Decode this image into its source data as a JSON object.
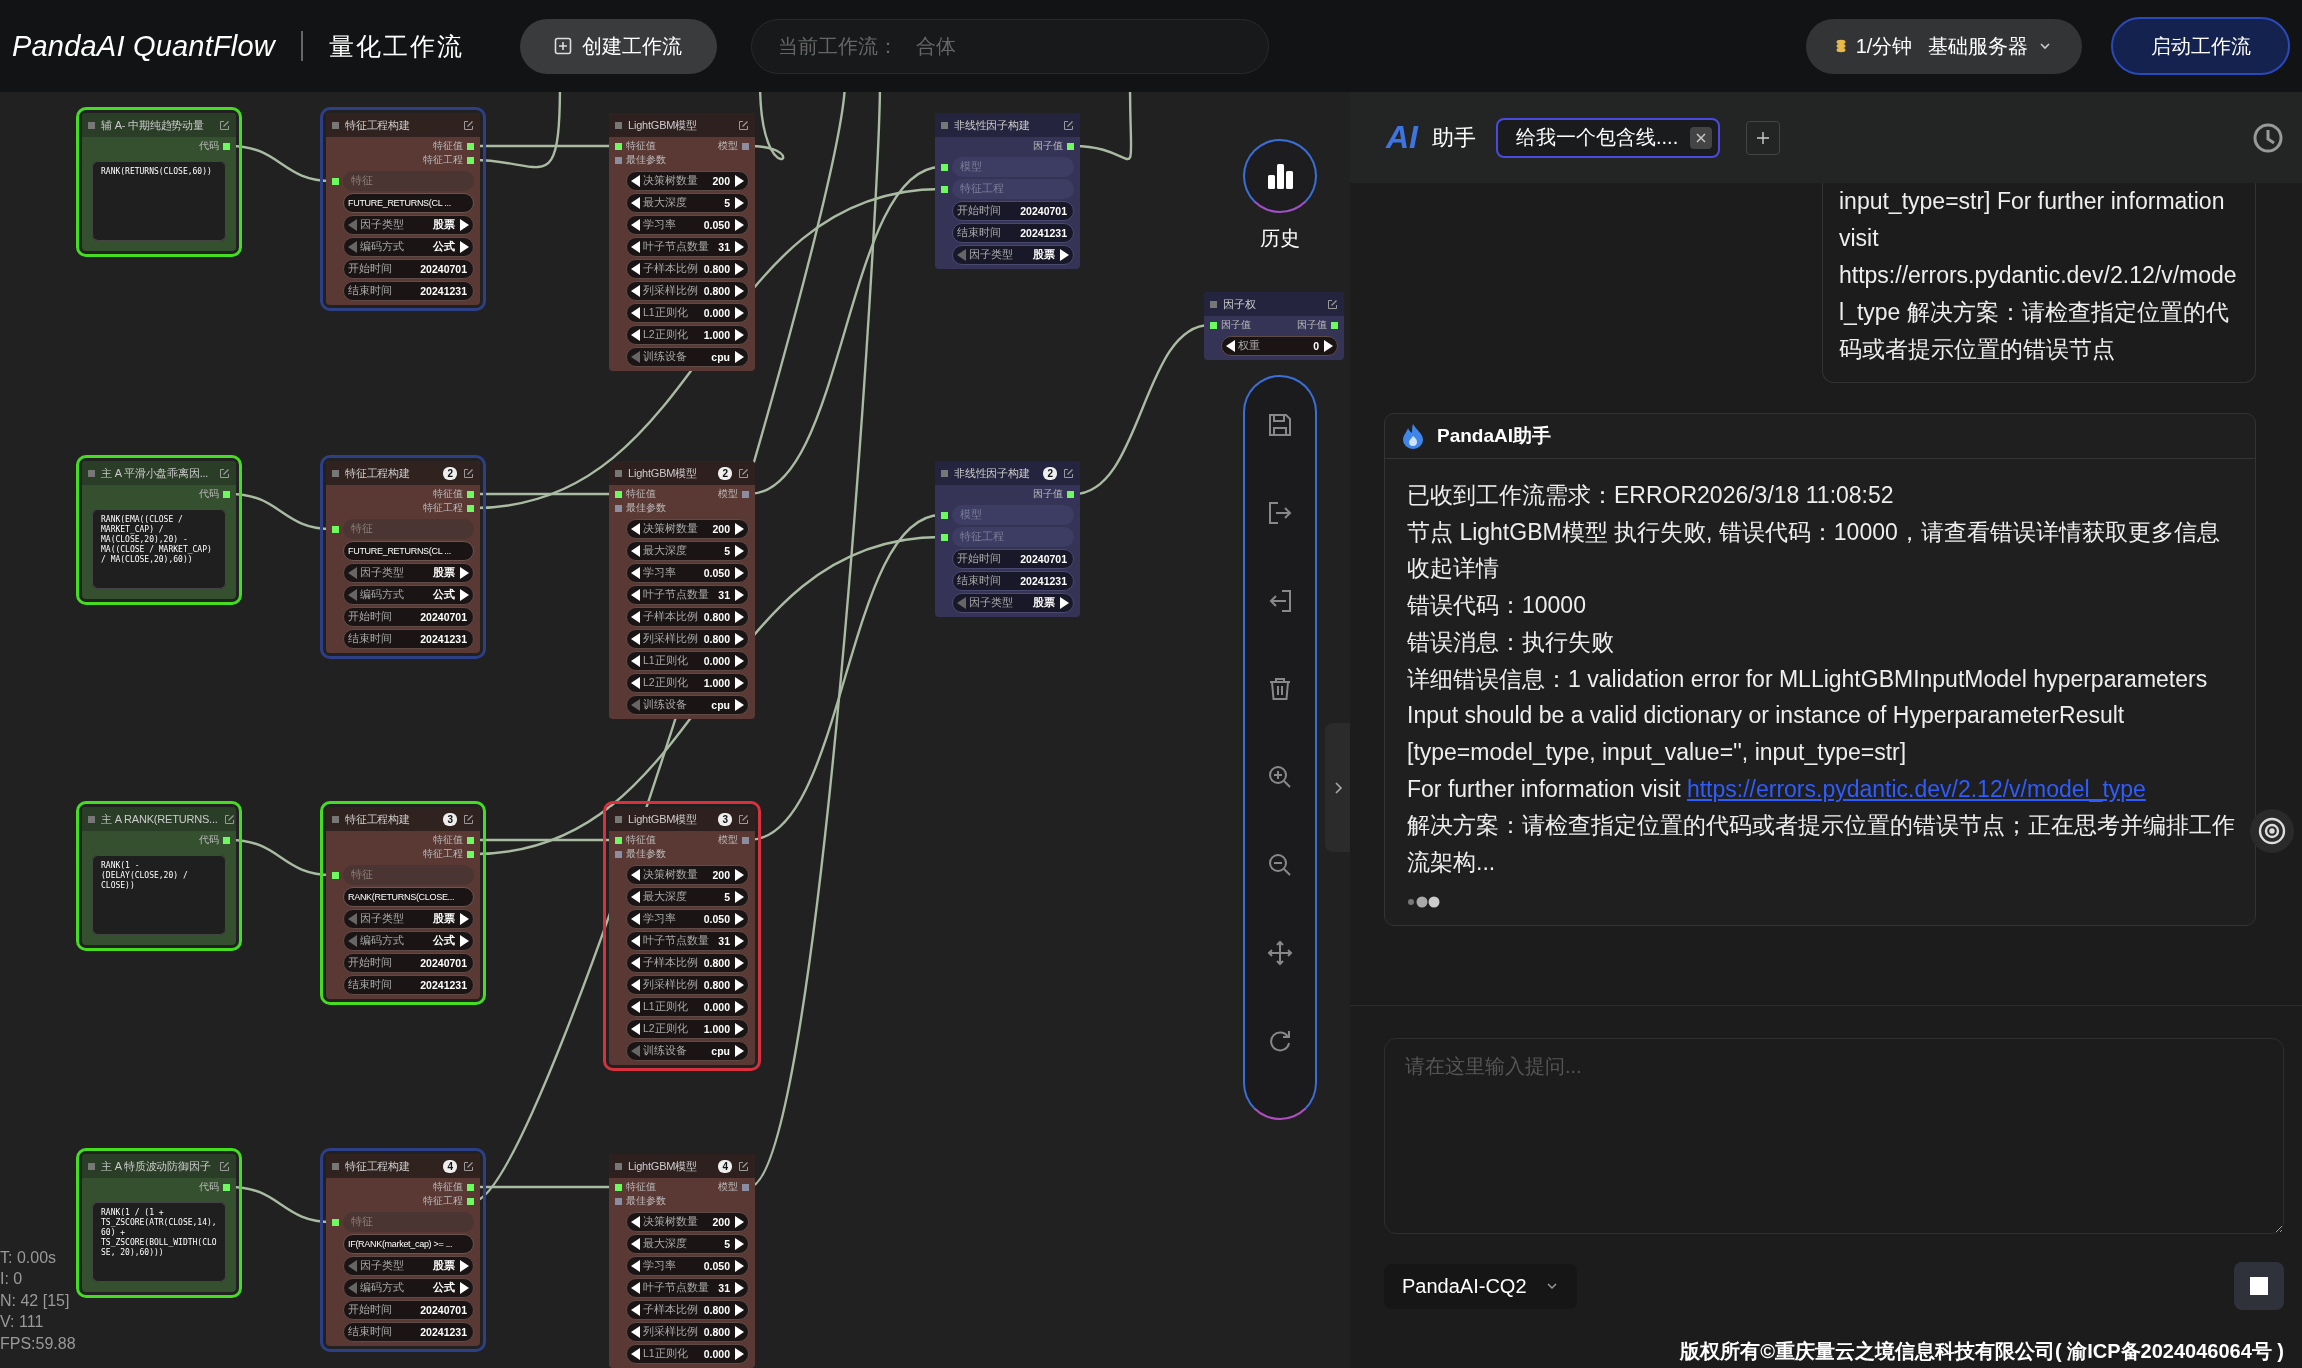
{
  "app": {
    "logo": "PandaAI QuantFlow",
    "subtitle": "量化工作流"
  },
  "toolbar": {
    "create_button": "创建工作流",
    "current_workflow": {
      "label": "当前工作流：",
      "value": "合体"
    },
    "server": {
      "rate": "1/分钟",
      "name": "基础服务器"
    },
    "start_button": "启动工作流"
  },
  "canvas": {
    "nodes": [
      {
        "kind": "code",
        "title": "辅 A- 中期纯趋势动量",
        "color": "#44dd22",
        "port_rows": [
          {
            "output": {
              "label": "代码",
              "connected": true
            }
          }
        ],
        "widgets": [
          {
            "kind": "code",
            "value": "RANK(RETURNS(CLOSE,60))"
          }
        ]
      },
      {
        "kind": "feature",
        "title": "特征工程构建",
        "color": "#2d3f86",
        "port_rows": [
          {
            "output": {
              "label": "特征值",
              "connected": true
            }
          },
          {
            "output": {
              "label": "特征工程",
              "connected": true
            }
          }
        ],
        "widgets": [
          {
            "kind": "input",
            "label": "特征",
            "connected": true
          },
          {
            "kind": "text",
            "value": "FUTURE_RETURNS(CL  ..."
          },
          {
            "kind": "combo",
            "label": "因子类型",
            "value": "股票"
          },
          {
            "kind": "combo",
            "label": "编码方式",
            "value": "公式"
          },
          {
            "kind": "field",
            "label": "开始时间",
            "value": "20240701"
          },
          {
            "kind": "field",
            "label": "结束时间",
            "value": "20241231"
          }
        ]
      },
      {
        "kind": "model",
        "title": "LightGBM模型",
        "port_rows": [
          {
            "input": {
              "label": "特征值",
              "connected": true
            },
            "output": {
              "label": "模型",
              "connected": false
            }
          },
          {
            "input": {
              "label": "最佳参数",
              "connected": false
            }
          }
        ],
        "widgets": [
          {
            "kind": "number",
            "label": "决策树数量",
            "value": "200"
          },
          {
            "kind": "number",
            "label": "最大深度",
            "value": "5"
          },
          {
            "kind": "number",
            "label": "学习率",
            "value": "0.050"
          },
          {
            "kind": "number",
            "label": "叶子节点数量",
            "value": "31"
          },
          {
            "kind": "number",
            "label": "子样本比例",
            "value": "0.800"
          },
          {
            "kind": "number",
            "label": "列采样比例",
            "value": "0.800"
          },
          {
            "kind": "number",
            "label": "L1正则化",
            "value": "0.000"
          },
          {
            "kind": "number",
            "label": "L2正则化",
            "value": "1.000"
          },
          {
            "kind": "combo",
            "label": "训练设备",
            "value": "cpu"
          }
        ]
      },
      {
        "kind": "nonlinear",
        "title": "非线性因子构建",
        "port_rows": [
          {
            "output": {
              "label": "因子值",
              "connected": true
            }
          }
        ],
        "widgets": [
          {
            "kind": "input",
            "label": "模型",
            "connected": true
          },
          {
            "kind": "input",
            "label": "特征工程",
            "connected": true
          },
          {
            "kind": "field",
            "label": "开始时间",
            "value": "20240701"
          },
          {
            "kind": "field",
            "label": "结束时间",
            "value": "20241231"
          },
          {
            "kind": "combo",
            "label": "因子类型",
            "value": "股票"
          }
        ]
      },
      {
        "kind": "weight",
        "title": "因子权",
        "port_rows": [
          {
            "input": {
              "label": "因子值",
              "connected": true
            },
            "output": {
              "label": "因子值",
              "connected": true
            }
          }
        ],
        "widgets": [
          {
            "kind": "number",
            "label": "权重",
            "value": "0"
          }
        ]
      },
      {
        "kind": "code",
        "title": "主 A 平滑小盘乖离因...",
        "color": "#44dd22",
        "port_rows": [
          {
            "output": {
              "label": "代码",
              "connected": true
            }
          }
        ],
        "widgets": [
          {
            "kind": "code",
            "value": "RANK(EMA((CLOSE / MARKET_CAP) / MA(CLOSE,20),20) - MA((CLOSE / MARKET_CAP) / MA(CLOSE,20),60))"
          }
        ]
      },
      {
        "kind": "feature",
        "title": "特征工程构建",
        "badge": "2",
        "color": "#2d3f86",
        "port_rows": [
          {
            "output": {
              "label": "特征值",
              "connected": true
            }
          },
          {
            "output": {
              "label": "特征工程",
              "connected": true
            }
          }
        ],
        "widgets": [
          {
            "kind": "input",
            "label": "特征",
            "connected": true
          },
          {
            "kind": "text",
            "value": "FUTURE_RETURNS(CL  ..."
          },
          {
            "kind": "combo",
            "label": "因子类型",
            "value": "股票"
          },
          {
            "kind": "combo",
            "label": "编码方式",
            "value": "公式"
          },
          {
            "kind": "field",
            "label": "开始时间",
            "value": "20240701"
          },
          {
            "kind": "field",
            "label": "结束时间",
            "value": "20241231"
          }
        ]
      },
      {
        "kind": "model",
        "title": "LightGBM模型",
        "badge": "2",
        "port_rows": [
          {
            "input": {
              "label": "特征值",
              "connected": true
            },
            "output": {
              "label": "模型",
              "connected": false
            }
          },
          {
            "input": {
              "label": "最佳参数",
              "connected": false
            }
          }
        ],
        "widgets": [
          {
            "kind": "number",
            "label": "决策树数量",
            "value": "200"
          },
          {
            "kind": "number",
            "label": "最大深度",
            "value": "5"
          },
          {
            "kind": "number",
            "label": "学习率",
            "value": "0.050"
          },
          {
            "kind": "number",
            "label": "叶子节点数量",
            "value": "31"
          },
          {
            "kind": "number",
            "label": "子样本比例",
            "value": "0.800"
          },
          {
            "kind": "number",
            "label": "列采样比例",
            "value": "0.800"
          },
          {
            "kind": "number",
            "label": "L1正则化",
            "value": "0.000"
          },
          {
            "kind": "number",
            "label": "L2正则化",
            "value": "1.000"
          },
          {
            "kind": "combo",
            "label": "训练设备",
            "value": "cpu"
          }
        ]
      },
      {
        "kind": "nonlinear",
        "title": "非线性因子构建",
        "badge": "2",
        "port_rows": [
          {
            "output": {
              "label": "因子值",
              "connected": true
            }
          }
        ],
        "widgets": [
          {
            "kind": "input",
            "label": "模型",
            "connected": true
          },
          {
            "kind": "input",
            "label": "特征工程",
            "connected": true
          },
          {
            "kind": "field",
            "label": "开始时间",
            "value": "20240701"
          },
          {
            "kind": "field",
            "label": "结束时间",
            "value": "20241231"
          },
          {
            "kind": "combo",
            "label": "因子类型",
            "value": "股票"
          }
        ]
      },
      {
        "kind": "code",
        "title": "主 A RANK(RETURNS...",
        "color": "#44dd22",
        "port_rows": [
          {
            "output": {
              "label": "代码",
              "connected": true
            }
          }
        ],
        "widgets": [
          {
            "kind": "code",
            "value": "RANK(1 - (DELAY(CLOSE,20) / CLOSE))"
          }
        ]
      },
      {
        "kind": "feature",
        "title": "特征工程构建",
        "badge": "3",
        "color": "#44dd22",
        "port_rows": [
          {
            "output": {
              "label": "特征值",
              "connected": true
            }
          },
          {
            "output": {
              "label": "特征工程",
              "connected": true
            }
          }
        ],
        "widgets": [
          {
            "kind": "input",
            "label": "特征",
            "connected": true
          },
          {
            "kind": "text",
            "value": "RANK(RETURNS(CLOSE..."
          },
          {
            "kind": "combo",
            "label": "因子类型",
            "value": "股票"
          },
          {
            "kind": "combo",
            "label": "编码方式",
            "value": "公式"
          },
          {
            "kind": "field",
            "label": "开始时间",
            "value": "20240701"
          },
          {
            "kind": "field",
            "label": "结束时间",
            "value": "20241231"
          }
        ]
      },
      {
        "kind": "model",
        "title": "LightGBM模型",
        "badge": "3",
        "color": "#d8303c",
        "port_rows": [
          {
            "input": {
              "label": "特征值",
              "connected": true
            },
            "output": {
              "label": "模型",
              "connected": false
            }
          },
          {
            "input": {
              "label": "最佳参数",
              "connected": false
            }
          }
        ],
        "widgets": [
          {
            "kind": "number",
            "label": "决策树数量",
            "value": "200"
          },
          {
            "kind": "number",
            "label": "最大深度",
            "value": "5"
          },
          {
            "kind": "number",
            "label": "学习率",
            "value": "0.050"
          },
          {
            "kind": "number",
            "label": "叶子节点数量",
            "value": "31"
          },
          {
            "kind": "number",
            "label": "子样本比例",
            "value": "0.800"
          },
          {
            "kind": "number",
            "label": "列采样比例",
            "value": "0.800"
          },
          {
            "kind": "number",
            "label": "L1正则化",
            "value": "0.000"
          },
          {
            "kind": "number",
            "label": "L2正则化",
            "value": "1.000"
          },
          {
            "kind": "combo",
            "label": "训练设备",
            "value": "cpu"
          }
        ]
      },
      {
        "kind": "code",
        "title": "主 A  特质波动防御因子",
        "color": "#44dd22",
        "port_rows": [
          {
            "output": {
              "label": "代码",
              "connected": true
            }
          }
        ],
        "widgets": [
          {
            "kind": "code",
            "value": "RANK(1 / (1 + TS_ZSCORE(ATR(CLOSE,14),60) + TS_ZSCORE(BOLL_WIDTH(CLOSE, 20),60)))"
          }
        ]
      },
      {
        "kind": "feature",
        "title": "特征工程构建",
        "badge": "4",
        "color": "#2d3f86",
        "port_rows": [
          {
            "output": {
              "label": "特征值",
              "connected": true
            }
          },
          {
            "output": {
              "label": "特征工程",
              "connected": true
            }
          }
        ],
        "widgets": [
          {
            "kind": "input",
            "label": "特征",
            "connected": true
          },
          {
            "kind": "text",
            "value": "IF(RANK(market_cap) >= ..."
          },
          {
            "kind": "combo",
            "label": "因子类型",
            "value": "股票"
          },
          {
            "kind": "combo",
            "label": "编码方式",
            "value": "公式"
          },
          {
            "kind": "field",
            "label": "开始时间",
            "value": "20240701"
          },
          {
            "kind": "field",
            "label": "结束时间",
            "value": "20241231"
          }
        ]
      },
      {
        "kind": "model",
        "title": "LightGBM模型",
        "badge": "4",
        "port_rows": [
          {
            "input": {
              "label": "特征值",
              "connected": true
            },
            "output": {
              "label": "模型",
              "connected": false
            }
          },
          {
            "input": {
              "label": "最佳参数",
              "connected": false
            }
          }
        ],
        "widgets": [
          {
            "kind": "number",
            "label": "决策树数量",
            "value": "200"
          },
          {
            "kind": "number",
            "label": "最大深度",
            "value": "5"
          },
          {
            "kind": "number",
            "label": "学习率",
            "value": "0.050"
          },
          {
            "kind": "number",
            "label": "叶子节点数量",
            "value": "31"
          },
          {
            "kind": "number",
            "label": "子样本比例",
            "value": "0.800"
          },
          {
            "kind": "number",
            "label": "列采样比例",
            "value": "0.800"
          },
          {
            "kind": "number",
            "label": "L1正则化",
            "value": "0.000"
          }
        ]
      }
    ],
    "stats": [
      "T: 0.00s",
      "I: 0",
      "N: 42 [15]",
      "V: 111",
      "FPS:59.88"
    ],
    "history_label": "历史"
  },
  "assistant": {
    "logo": "AI",
    "title": "助手",
    "chats": [
      {
        "label": "给我一个包含线....",
        "selected": true
      }
    ],
    "messages": [
      {
        "kind": "partial",
        "paragraphs": [
          {
            "text": "input_type=str] For further information visit https://errors.pydantic.dev/2.12/v/model_type 解决方案：请检查指定位置的代码或者提示位置的错误节点"
          }
        ]
      },
      {
        "kind": "bot",
        "sender": "PandaAI助手",
        "typing": true,
        "paragraphs": [
          {
            "text": "已收到工作流需求：ERROR2026/3/18 11:08:52"
          },
          {
            "text": "节点 LightGBM模型 执行失败, 错误代码：10000，请查看错误详情获取更多信息收起详情"
          },
          {
            "text": "错误代码：10000"
          },
          {
            "text": "错误消息：执行失败"
          },
          {
            "text": "详细错误信息：1 validation error for MLLightGBMInputModel hyperparameters"
          },
          {
            "text": "Input should be a valid dictionary or instance of HyperparameterResult [type=model_type, input_value='', input_type=str]"
          },
          {
            "text": "For further information visit ",
            "link": "https://errors.pydantic.dev/2.12/v/model_type"
          },
          {
            "text": "解决方案：请检查指定位置的代码或者提示位置的错误节点；正在思考并编排工作流架构..."
          }
        ]
      }
    ],
    "input": {
      "placeholder": "请在这里输入提问..."
    },
    "model": "PandaAI-CQ2"
  },
  "footer": "版权所有©重庆量云之境信息科技有限公司( 渝ICP备2024046064号 )"
}
